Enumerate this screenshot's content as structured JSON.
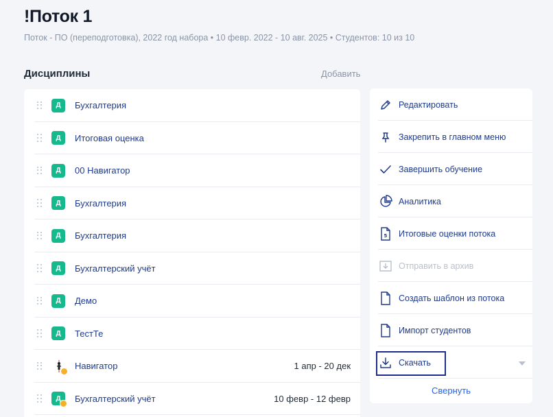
{
  "header": {
    "title": "!Поток 1",
    "meta": "Поток - ПО (переподготовка), 2022 год набора • 10 февр. 2022 - 10 авг. 2025 • Студентов: 10 из 10"
  },
  "disciplines": {
    "title": "Дисциплины",
    "add_label": "Добавить",
    "items": [
      {
        "badge": "Д",
        "name": "Бухгалтерия",
        "date": ""
      },
      {
        "badge": "Д",
        "name": "Итоговая оценка",
        "date": ""
      },
      {
        "badge": "Д",
        "name": "00 Навигатор",
        "date": ""
      },
      {
        "badge": "Д",
        "name": "Бухгалтерия",
        "date": ""
      },
      {
        "badge": "Д",
        "name": "Бухгалтерия",
        "date": ""
      },
      {
        "badge": "Д",
        "name": "Бухгалтерский учёт",
        "date": ""
      },
      {
        "badge": "Д",
        "name": "Демо",
        "date": ""
      },
      {
        "badge": "Д",
        "name": "ТестТе",
        "date": ""
      },
      {
        "badge": "",
        "name": "Навигатор",
        "date": "1 апр - 20 дек"
      },
      {
        "badge": "Д",
        "name": "Бухгалтерский учёт",
        "date": "10 февр - 12 февр"
      }
    ]
  },
  "actions": {
    "items": [
      {
        "icon": "pencil-icon",
        "label": "Редактировать"
      },
      {
        "icon": "pin-icon",
        "label": "Закрепить в главном меню"
      },
      {
        "icon": "check-icon",
        "label": "Завершить обучение"
      },
      {
        "icon": "pie-chart-icon",
        "label": "Аналитика"
      },
      {
        "icon": "grade-document-icon",
        "label": "Итоговые оценки потока"
      },
      {
        "icon": "archive-icon",
        "label": "Отправить в архив"
      },
      {
        "icon": "document-icon",
        "label": "Создать шаблон из потока"
      },
      {
        "icon": "document-icon",
        "label": "Импорт студентов"
      },
      {
        "icon": "download-icon",
        "label": "Скачать"
      }
    ],
    "collapse_label": "Свернуть"
  },
  "colors": {
    "accent": "#1e3a8a",
    "badge": "#16b88e",
    "badge_dot": "#f5b027",
    "link": "#2563eb",
    "focus_outline": "#1b2c8c"
  }
}
